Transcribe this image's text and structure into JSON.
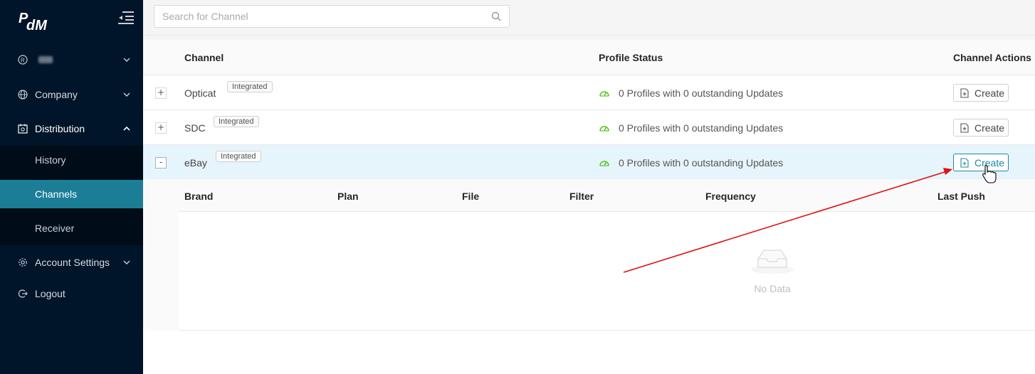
{
  "brand": {
    "logo_text": "PdM"
  },
  "sidebar": {
    "items": [
      {
        "label": "",
        "icon": "registered-icon"
      },
      {
        "label": "Company",
        "icon": "globe-icon"
      },
      {
        "label": "Distribution",
        "icon": "calendar-sync-icon"
      },
      {
        "label": "Account Settings",
        "icon": "gear-icon"
      },
      {
        "label": "Logout",
        "icon": "logout-icon"
      }
    ],
    "subitems": [
      {
        "label": "History"
      },
      {
        "label": "Channels"
      },
      {
        "label": "Receiver"
      }
    ],
    "selected": "Channels"
  },
  "search": {
    "placeholder": "Search for Channel"
  },
  "table": {
    "headers": {
      "channel": "Channel",
      "profile_status": "Profile Status",
      "actions": "Channel Actions"
    },
    "rows": [
      {
        "expander": "+",
        "name": "Opticat",
        "tag": "Integrated",
        "status": "0 Profiles with 0 outstanding Updates",
        "action": "Create"
      },
      {
        "expander": "+",
        "name": "SDC",
        "tag": "Integrated",
        "status": "0 Profiles with 0 outstanding Updates",
        "action": "Create"
      },
      {
        "expander": "-",
        "name": "eBay",
        "tag": "Integrated",
        "status": "0 Profiles with 0 outstanding Updates",
        "action": "Create"
      }
    ]
  },
  "nested": {
    "headers": [
      "Brand",
      "Plan",
      "File",
      "Filter",
      "Frequency",
      "Last Push"
    ],
    "empty_text": "No Data"
  },
  "colors": {
    "sidebar_bg": "#001529",
    "selected_bg": "#1c7d97",
    "status_icon": "#52c41a",
    "annotation_arrow": "#e01010"
  }
}
